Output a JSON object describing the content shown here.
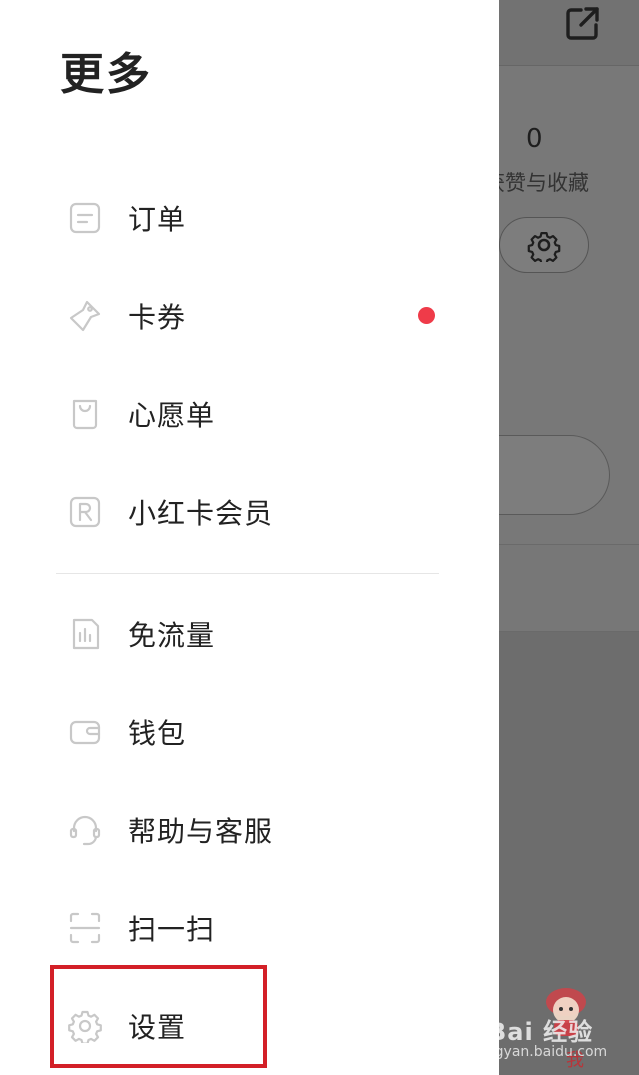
{
  "drawer": {
    "title": "更多",
    "items": [
      {
        "label": "订单",
        "icon": "order-icon"
      },
      {
        "label": "卡券",
        "icon": "coupon-icon",
        "has_badge": true
      },
      {
        "label": "心愿单",
        "icon": "wishlist-bag-icon"
      },
      {
        "label": "小红卡会员",
        "icon": "membership-r-icon"
      },
      {
        "label": "免流量",
        "icon": "data-free-icon"
      },
      {
        "label": "钱包",
        "icon": "wallet-icon"
      },
      {
        "label": "帮助与客服",
        "icon": "customer-service-icon"
      },
      {
        "label": "扫一扫",
        "icon": "scan-icon"
      },
      {
        "label": "设置",
        "icon": "settings-gear-icon",
        "highlighted": true
      }
    ]
  },
  "background_profile": {
    "likes_count": "0",
    "likes_label": "获赞与收藏",
    "bottom_tab_label": "我",
    "watermark_main": "Bai 经验",
    "watermark_sub": "jingyan.baidu.com"
  },
  "colors": {
    "accent_red": "#ef3b49",
    "highlight_box": "#d32027",
    "overlay": "#6f6f6f"
  }
}
